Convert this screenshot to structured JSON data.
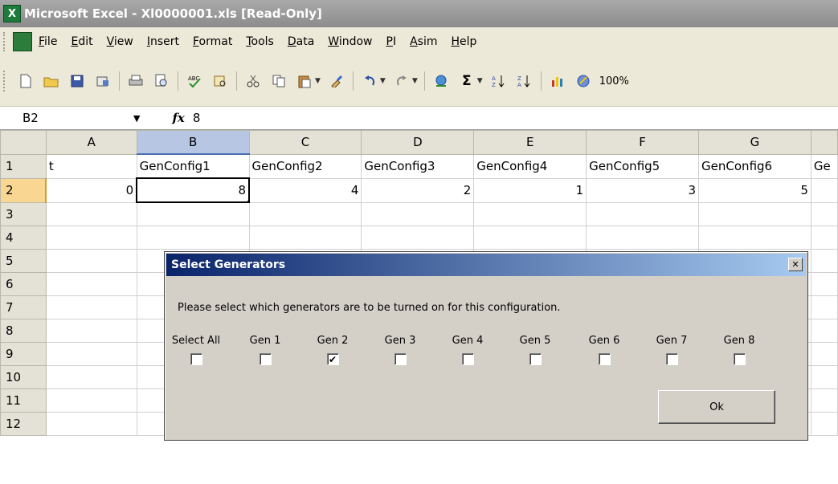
{
  "window": {
    "title": "Microsoft Excel - Xl0000001.xls  [Read-Only]"
  },
  "menu": [
    "File",
    "Edit",
    "View",
    "Insert",
    "Format",
    "Tools",
    "Data",
    "Window",
    "PI",
    "Asim",
    "Help"
  ],
  "toolbar": {
    "zoom": "100%"
  },
  "formula_bar": {
    "name_box": "B2",
    "fx": "fx",
    "value": "8"
  },
  "sheet": {
    "columns": [
      "A",
      "B",
      "C",
      "D",
      "E",
      "F",
      "G"
    ],
    "rows": [
      "1",
      "2",
      "3",
      "4",
      "5",
      "6",
      "7",
      "8",
      "9",
      "10",
      "11",
      "12"
    ],
    "row1": [
      "t",
      "GenConfig1",
      "GenConfig2",
      "GenConfig3",
      "GenConfig4",
      "GenConfig5",
      "GenConfig6",
      "Ge"
    ],
    "row2": [
      "0",
      "8",
      "4",
      "2",
      "1",
      "3",
      "5"
    ]
  },
  "dialog": {
    "title": "Select Generators",
    "close": "✕",
    "message": "Please select which generators are to be turned on for this configuration.",
    "options": [
      {
        "label": "Select All",
        "checked": false
      },
      {
        "label": "Gen 1",
        "checked": false
      },
      {
        "label": "Gen 2",
        "checked": true
      },
      {
        "label": "Gen 3",
        "checked": false
      },
      {
        "label": "Gen 4",
        "checked": false
      },
      {
        "label": "Gen 5",
        "checked": false
      },
      {
        "label": "Gen 6",
        "checked": false
      },
      {
        "label": "Gen 7",
        "checked": false
      },
      {
        "label": "Gen 8",
        "checked": false
      }
    ],
    "ok": "Ok"
  }
}
